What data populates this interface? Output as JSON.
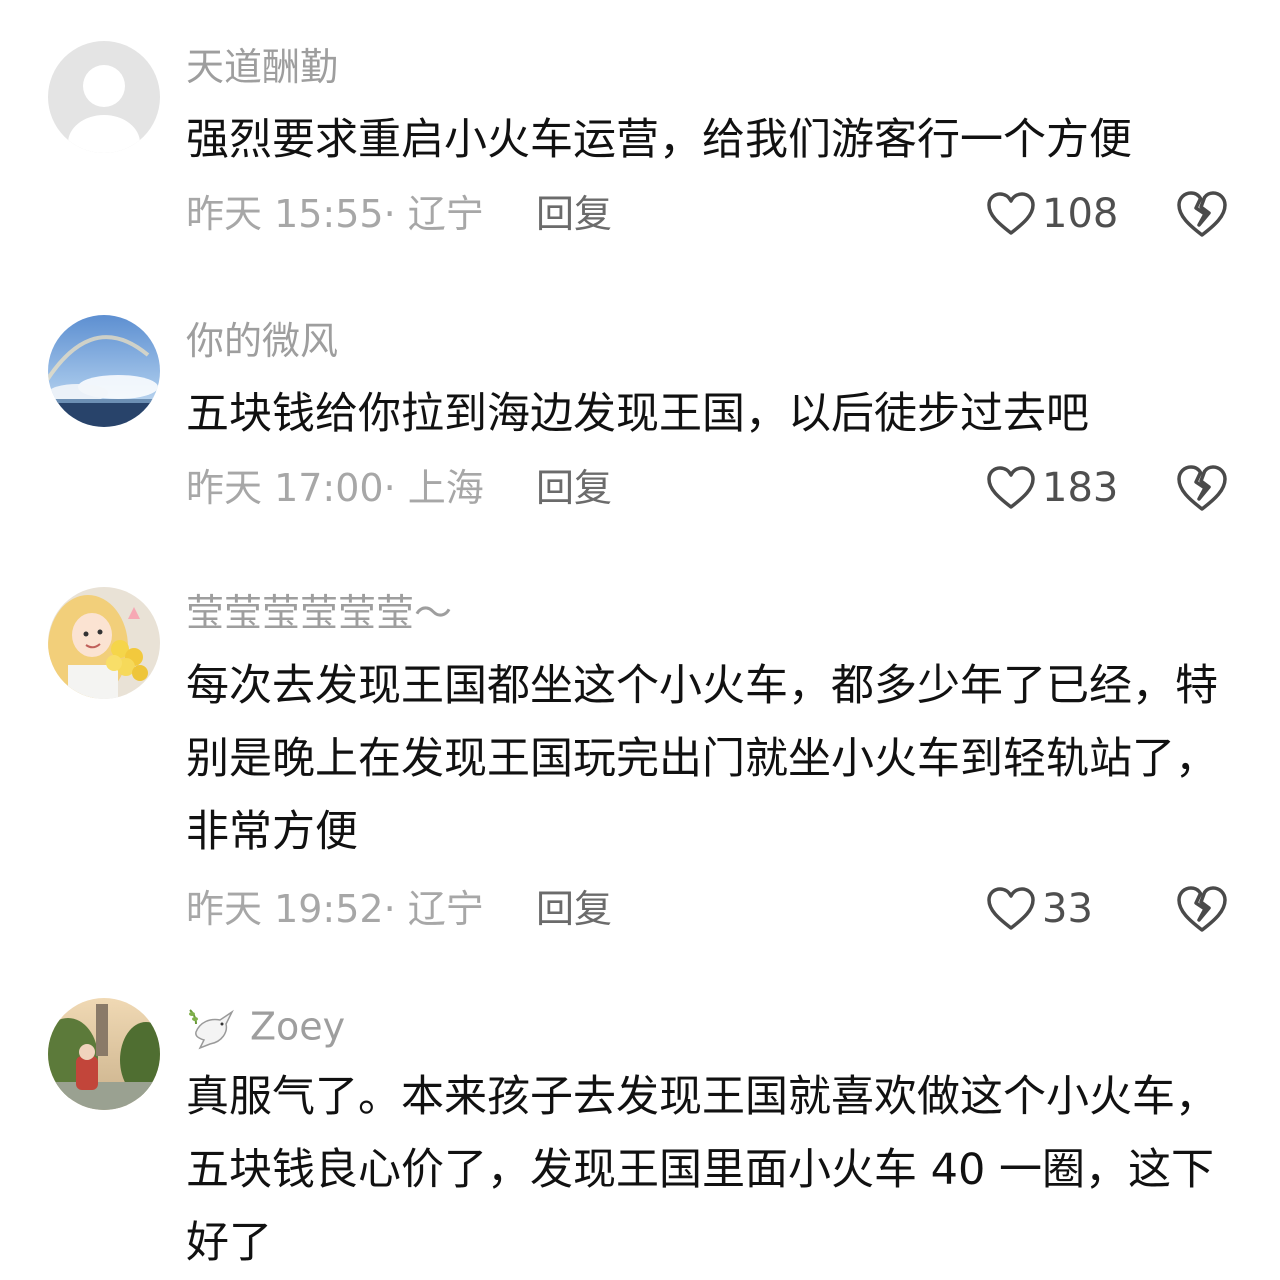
{
  "comments": [
    {
      "username": "天道酬勤",
      "text": "强烈要求重启小火车运营，给我们游客行一个方便",
      "time": "昨天 15:55",
      "location": "辽宁",
      "reply_label": "回复",
      "likes": "108",
      "avatar_icon": "default-avatar-icon"
    },
    {
      "username": "你的微风",
      "text": "五块钱给你拉到海边发现王国，以后徒步过去吧",
      "time": "昨天 17:00",
      "location": "上海",
      "reply_label": "回复",
      "likes": "183",
      "avatar_icon": "rainbow-sky-avatar"
    },
    {
      "username": "莹莹莹莹莹莹～",
      "text": "每次去发现王国都坐这个小火车，都多少年了已经，特别是晚上在发现王国玩完出门就坐小火车到轻轨站了，非常方便",
      "time": "昨天 19:52",
      "location": "辽宁",
      "reply_label": "回复",
      "likes": "33",
      "avatar_icon": "cartoon-girl-avatar"
    },
    {
      "username": "Zoey",
      "username_icon": "dove-icon",
      "text": "真服气了。本来孩子去发现王国就喜欢做这个小火车，五块钱良心价了，发现王国里面小火车 40 一圈，这下好了",
      "avatar_icon": "garden-photo-avatar"
    }
  ],
  "meta_separator": "· ",
  "colors": {
    "username": "#9e9e9e",
    "body_text": "#111111",
    "meta_text": "#a7a7a7",
    "reply_text": "#6b6b6b",
    "like_count": "#4f4f4f"
  }
}
